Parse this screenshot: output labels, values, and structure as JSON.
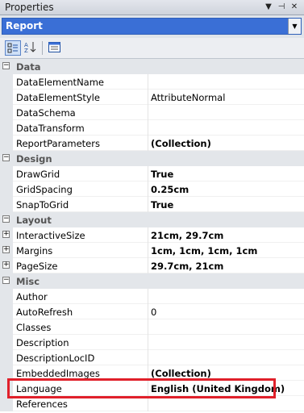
{
  "window": {
    "title": "Properties"
  },
  "object_selector": {
    "value": "Report"
  },
  "toolbar": {
    "buttons": [
      "categorized-icon",
      "alphabetical-icon",
      "property-pages-icon"
    ]
  },
  "grid": {
    "categories": [
      {
        "label": "Data",
        "rows": [
          {
            "name": "DataElementName",
            "value": ""
          },
          {
            "name": "DataElementStyle",
            "value": "AttributeNormal"
          },
          {
            "name": "DataSchema",
            "value": ""
          },
          {
            "name": "DataTransform",
            "value": ""
          },
          {
            "name": "ReportParameters",
            "value": "(Collection)"
          }
        ]
      },
      {
        "label": "Design",
        "rows": [
          {
            "name": "DrawGrid",
            "value": "True"
          },
          {
            "name": "GridSpacing",
            "value": "0.25cm"
          },
          {
            "name": "SnapToGrid",
            "value": "True"
          }
        ]
      },
      {
        "label": "Layout",
        "rows": [
          {
            "name": "InteractiveSize",
            "value": "21cm, 29.7cm"
          },
          {
            "name": "Margins",
            "value": "1cm, 1cm, 1cm, 1cm"
          },
          {
            "name": "PageSize",
            "value": "29.7cm, 21cm"
          }
        ]
      },
      {
        "label": "Misc",
        "rows": [
          {
            "name": "Author",
            "value": ""
          },
          {
            "name": "AutoRefresh",
            "value": "0"
          },
          {
            "name": "Classes",
            "value": ""
          },
          {
            "name": "Description",
            "value": ""
          },
          {
            "name": "DescriptionLocID",
            "value": ""
          },
          {
            "name": "EmbeddedImages",
            "value": "(Collection)"
          },
          {
            "name": "Language",
            "value": "English (United Kingdom)"
          },
          {
            "name": "References",
            "value": ""
          }
        ]
      }
    ],
    "expand_symbol": "+",
    "collapse_symbol": "−"
  },
  "colors": {
    "highlight_border": "#e0202a",
    "selector_bg": "#3a6fd6"
  }
}
